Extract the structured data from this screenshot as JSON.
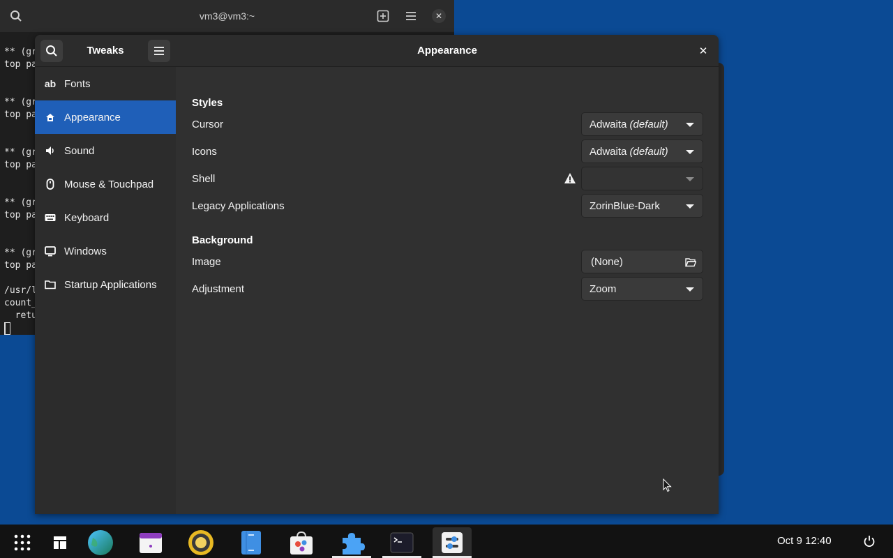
{
  "terminal": {
    "title": "vm3@vm3:~",
    "lines": [
      "** (gr",
      "top pa",
      "",
      "",
      "** (gr",
      "top pa",
      "",
      "",
      "** (gr",
      "top pa",
      "",
      "",
      "** (gr",
      "top pa",
      "",
      "",
      "** (gr",
      "top pa",
      "",
      "/usr/l",
      "count_",
      "  retu"
    ]
  },
  "tweaks": {
    "title": "Tweaks",
    "page_title": "Appearance",
    "nav": [
      {
        "label": "Fonts",
        "icon": "ab"
      },
      {
        "label": "Appearance",
        "icon": "appearance-icon"
      },
      {
        "label": "Sound",
        "icon": "speaker-icon"
      },
      {
        "label": "Mouse & Touchpad",
        "icon": "mouse-icon"
      },
      {
        "label": "Keyboard",
        "icon": "keyboard-icon"
      },
      {
        "label": "Windows",
        "icon": "window-icon"
      },
      {
        "label": "Startup Applications",
        "icon": "folder-icon"
      }
    ],
    "active_nav": "Appearance",
    "styles": {
      "heading": "Styles",
      "cursor_label": "Cursor",
      "cursor_value": "Adwaita",
      "cursor_suffix": "(default)",
      "icons_label": "Icons",
      "icons_value": "Adwaita",
      "icons_suffix": "(default)",
      "shell_label": "Shell",
      "shell_value": "",
      "legacy_label": "Legacy Applications",
      "legacy_value": "ZorinBlue-Dark"
    },
    "background": {
      "heading": "Background",
      "image_label": "Image",
      "image_value": "(None)",
      "adjustment_label": "Adjustment",
      "adjustment_value": "Zoom"
    }
  },
  "taskbar": {
    "apps": [
      "app-grid",
      "workspaces",
      "browser",
      "calendar",
      "music-player",
      "file-manager",
      "software-store",
      "extensions",
      "terminal",
      "tweaks"
    ],
    "clock": "Oct 9  12:40"
  },
  "colors": {
    "desktop": "#0b4a94",
    "accent": "#1f5fb8",
    "window_bg": "#303030",
    "sidebar_bg": "#2c2c2c",
    "taskbar_bg": "#121212"
  }
}
